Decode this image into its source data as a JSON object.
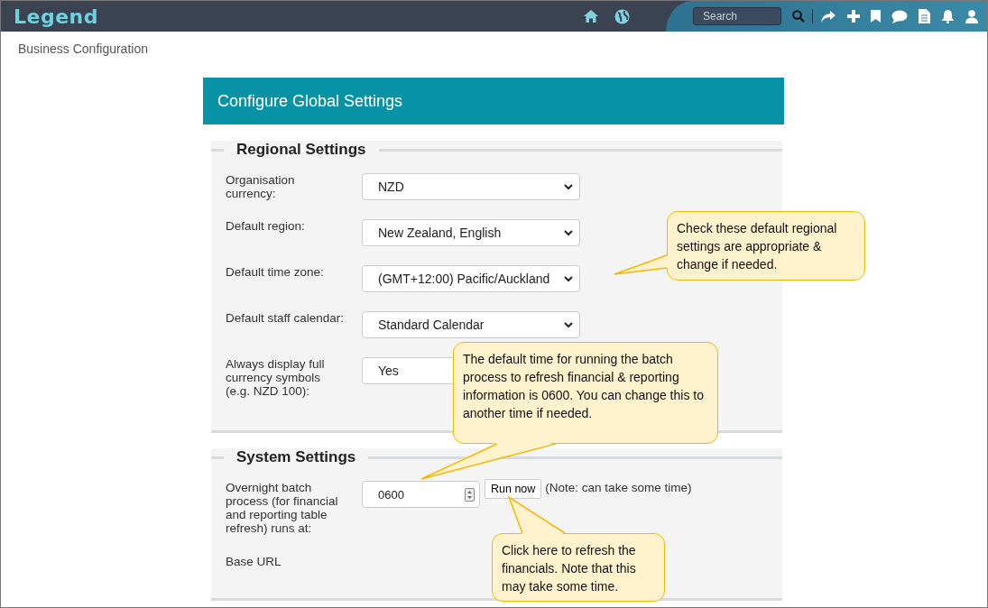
{
  "app": {
    "logo": "Legend",
    "search": {
      "placeholder": "Search"
    }
  },
  "breadcrumb": "Business Configuration",
  "panel": {
    "title": "Configure Global Settings",
    "sections": [
      {
        "title": "Regional Settings",
        "rows": [
          {
            "kind": "select",
            "label": "Organisation currency:",
            "value": "NZD"
          },
          {
            "kind": "select",
            "label": "Default region:",
            "value": "New Zealand, English"
          },
          {
            "kind": "select",
            "label": "Default time zone:",
            "value": "(GMT+12:00) Pacific/Auckland"
          },
          {
            "kind": "select",
            "label": "Default staff calendar:",
            "value": "Standard Calendar"
          },
          {
            "kind": "select",
            "label": "Always display full currency symbols (e.g. NZD 100):",
            "value": "Yes"
          }
        ]
      },
      {
        "title": "System Settings",
        "rows": [
          {
            "kind": "time",
            "label": "Overnight batch process (for financial and reporting table refresh) runs at:",
            "value": "0600",
            "button": "Run now",
            "note": "(Note: can take some time)"
          },
          {
            "kind": "plain",
            "label": "Base URL"
          }
        ]
      }
    ]
  },
  "callouts": [
    {
      "text": "Check these default regional settings are appropriate & change if needed."
    },
    {
      "text": "The default time for running the batch process to refresh financial & reporting information is 0600.  You can change this to another time if needed."
    },
    {
      "text": "Click here to refresh the financials.  Note that this may take some time."
    }
  ]
}
